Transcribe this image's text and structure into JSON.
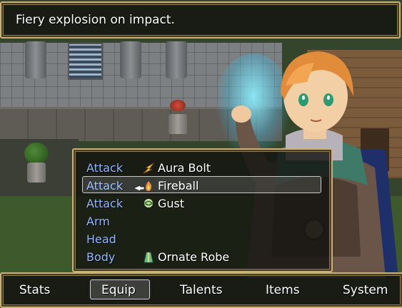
{
  "help": {
    "text": "Fiery explosion on impact."
  },
  "equipment": [
    {
      "slot": "Attack",
      "item": "Aura Bolt",
      "icon": "aura-bolt-icon"
    },
    {
      "slot": "Attack",
      "item": "Fireball",
      "icon": "fireball-icon"
    },
    {
      "slot": "Attack",
      "item": "Gust",
      "icon": "gust-icon"
    },
    {
      "slot": "Arm",
      "item": "",
      "icon": ""
    },
    {
      "slot": "Head",
      "item": "",
      "icon": ""
    },
    {
      "slot": "Body",
      "item": "Ornate Robe",
      "icon": "robe-icon"
    }
  ],
  "selected_row": 1,
  "menu": {
    "stats": "Stats",
    "equip": "Equip",
    "talents": "Talents",
    "items": "Items",
    "system": "System",
    "selected": "Equip"
  },
  "colors": {
    "slot_label": "#8fb7ff",
    "window_border": "#c9b27a"
  }
}
